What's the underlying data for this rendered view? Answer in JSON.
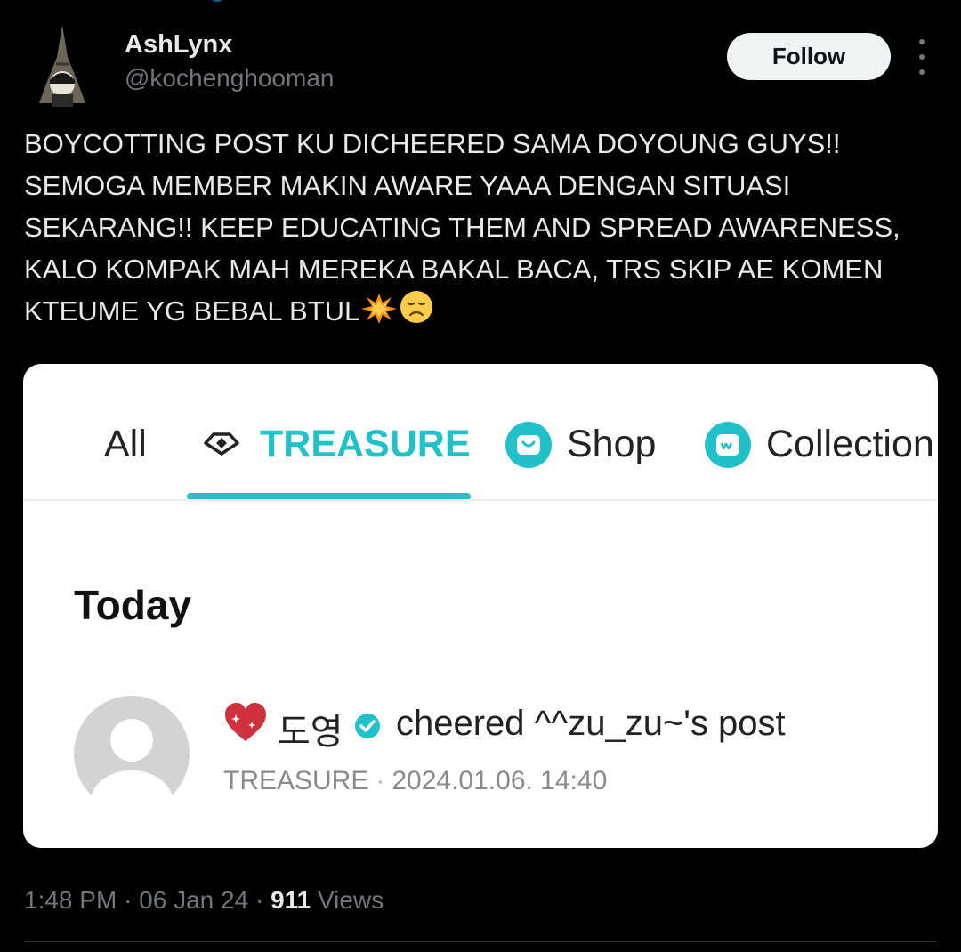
{
  "tweet": {
    "author_name": "AshLynx",
    "author_handle": "@kochenghooman",
    "follow_label": "Follow",
    "text": "BOYCOTTING POST KU DICHEERED SAMA DOYOUNG GUYS!! SEMOGA MEMBER MAKIN AWARE YAAA DENGAN SITUASI SEKARANG!! KEEP EDUCATING THEM AND SPREAD AWARENESS, KALO KOMPAK MAH MEREKA BAKAL BACA, TRS SKIP AE KOMEN KTEUME YG BEBAL BTUL",
    "trailing_emojis": [
      "collision-emoji",
      "disappointed-face-emoji"
    ],
    "time": "1:48 PM",
    "date": "06 Jan 24",
    "views_count": "911",
    "views_label": "Views"
  },
  "embedded_screenshot": {
    "tabs": [
      {
        "label": "All"
      },
      {
        "label": "TREASURE",
        "active": true
      },
      {
        "label": "Shop"
      },
      {
        "label": "Collection"
      }
    ],
    "section_title": "Today",
    "notification": {
      "member_name": "도영",
      "action_text": "cheered ^^zu_zu~'s post",
      "community": "TREASURE",
      "separator": "·",
      "datetime": "2024.01.06. 14:40"
    },
    "accent_color": "#20c1c8"
  }
}
